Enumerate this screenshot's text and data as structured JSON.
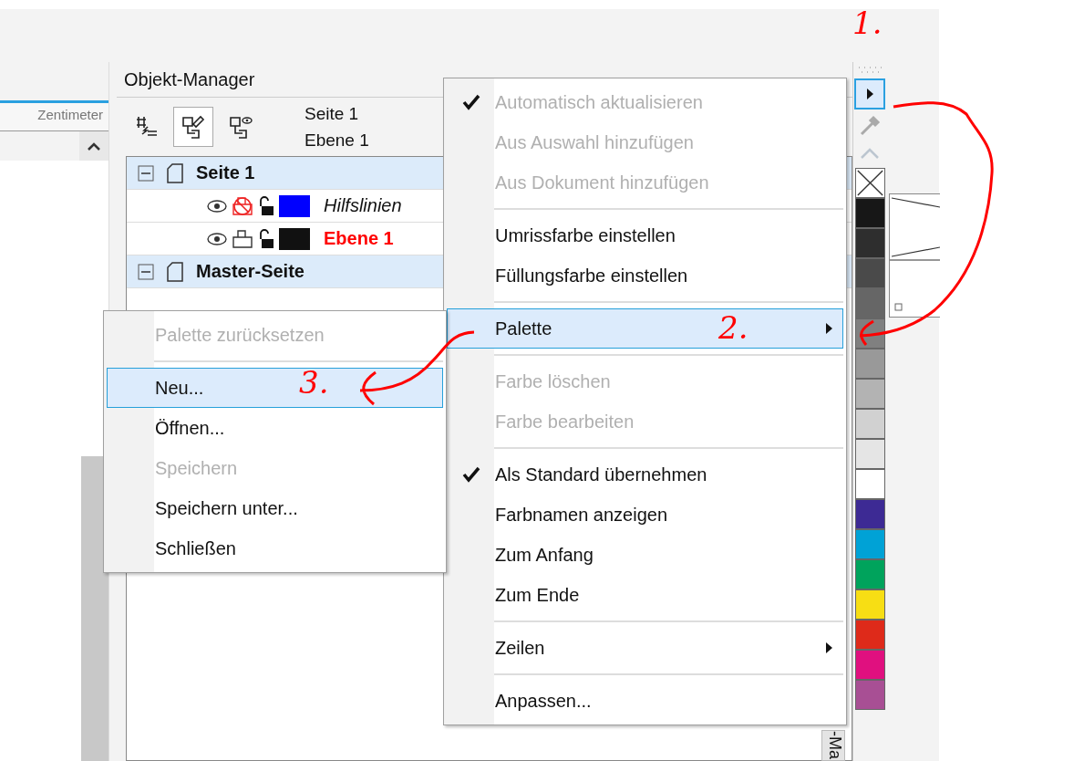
{
  "ruler": {
    "unit": "Zentimeter"
  },
  "object_manager": {
    "title": "Objekt-Manager",
    "toolbar": [
      {
        "selected": false
      },
      {
        "selected": true
      },
      {
        "selected": false
      }
    ],
    "current": {
      "page": "Seite 1",
      "layer": "Ebene 1"
    },
    "tree": [
      {
        "kind": "page",
        "name": "Seite 1",
        "expanded": true,
        "children": [
          {
            "kind": "layer",
            "name": "Hilfslinien",
            "visible": true,
            "printable": false,
            "locked": false,
            "color": "#0000ff",
            "active": false,
            "guides": true
          },
          {
            "kind": "layer",
            "name": "Ebene 1",
            "visible": true,
            "printable": true,
            "locked": false,
            "color": "#111111",
            "active": true,
            "guides": false
          }
        ]
      },
      {
        "kind": "page",
        "name": "Master-Seite",
        "expanded": true
      }
    ],
    "side_tab": "-Ma"
  },
  "context_menu": {
    "items": [
      {
        "kind": "item",
        "label": "Automatisch aktualisieren",
        "disabled": true,
        "checked": true,
        "submenu": false,
        "selected": false
      },
      {
        "kind": "item",
        "label": "Aus Auswahl hinzufügen",
        "disabled": true,
        "checked": false,
        "submenu": false,
        "selected": false
      },
      {
        "kind": "item",
        "label": "Aus Dokument hinzufügen",
        "disabled": true,
        "checked": false,
        "submenu": false,
        "selected": false
      },
      {
        "kind": "separator"
      },
      {
        "kind": "item",
        "label": "Umrissfarbe einstellen",
        "disabled": false,
        "checked": false,
        "submenu": false,
        "selected": false
      },
      {
        "kind": "item",
        "label": "Füllungsfarbe einstellen",
        "disabled": false,
        "checked": false,
        "submenu": false,
        "selected": false
      },
      {
        "kind": "separator"
      },
      {
        "kind": "item",
        "label": "Palette",
        "disabled": false,
        "checked": false,
        "submenu": true,
        "selected": true
      },
      {
        "kind": "separator"
      },
      {
        "kind": "item",
        "label": "Farbe löschen",
        "disabled": true,
        "checked": false,
        "submenu": false,
        "selected": false
      },
      {
        "kind": "item",
        "label": "Farbe bearbeiten",
        "disabled": true,
        "checked": false,
        "submenu": false,
        "selected": false
      },
      {
        "kind": "separator"
      },
      {
        "kind": "item",
        "label": "Als Standard übernehmen",
        "disabled": false,
        "checked": true,
        "submenu": false,
        "selected": false
      },
      {
        "kind": "item",
        "label": "Farbnamen anzeigen",
        "disabled": false,
        "checked": false,
        "submenu": false,
        "selected": false
      },
      {
        "kind": "item",
        "label": "Zum Anfang",
        "disabled": false,
        "checked": false,
        "submenu": false,
        "selected": false
      },
      {
        "kind": "item",
        "label": "Zum Ende",
        "disabled": false,
        "checked": false,
        "submenu": false,
        "selected": false
      },
      {
        "kind": "separator"
      },
      {
        "kind": "item",
        "label": "Zeilen",
        "disabled": false,
        "checked": false,
        "submenu": true,
        "selected": false
      },
      {
        "kind": "separator"
      },
      {
        "kind": "item",
        "label": "Anpassen...",
        "disabled": false,
        "checked": false,
        "submenu": false,
        "selected": false
      }
    ]
  },
  "palette_submenu": {
    "items": [
      {
        "kind": "item",
        "label": "Palette zurücksetzen",
        "disabled": true,
        "checked": false,
        "submenu": false,
        "selected": false
      },
      {
        "kind": "separator"
      },
      {
        "kind": "item",
        "label": "Neu...",
        "disabled": false,
        "checked": false,
        "submenu": false,
        "selected": true
      },
      {
        "kind": "item",
        "label": "Öffnen...",
        "disabled": false,
        "checked": false,
        "submenu": false,
        "selected": false
      },
      {
        "kind": "item",
        "label": "Speichern",
        "disabled": true,
        "checked": false,
        "submenu": false,
        "selected": false
      },
      {
        "kind": "item",
        "label": "Speichern unter...",
        "disabled": false,
        "checked": false,
        "submenu": false,
        "selected": false
      },
      {
        "kind": "item",
        "label": "Schließen",
        "disabled": false,
        "checked": false,
        "submenu": false,
        "selected": false
      }
    ]
  },
  "palette": {
    "menu_button_selected": true,
    "swatches": [
      {
        "kind": "none"
      },
      {
        "kind": "color",
        "color": "#171717"
      },
      {
        "kind": "color",
        "color": "#2e2e2e"
      },
      {
        "kind": "color",
        "color": "#4a4a4a"
      },
      {
        "kind": "color",
        "color": "#666666"
      },
      {
        "kind": "color",
        "color": "#808080"
      },
      {
        "kind": "color",
        "color": "#999999"
      },
      {
        "kind": "color",
        "color": "#b3b3b3"
      },
      {
        "kind": "color",
        "color": "#d1d1d1"
      },
      {
        "kind": "color",
        "color": "#e5e5e5"
      },
      {
        "kind": "color",
        "color": "#ffffff"
      },
      {
        "kind": "color",
        "color": "#3d2a94"
      },
      {
        "kind": "color",
        "color": "#00a2d6"
      },
      {
        "kind": "color",
        "color": "#00a35c"
      },
      {
        "kind": "color",
        "color": "#f7de14"
      },
      {
        "kind": "color",
        "color": "#de2a1a"
      },
      {
        "kind": "color",
        "color": "#e0107f"
      },
      {
        "kind": "color",
        "color": "#a84f94"
      }
    ]
  },
  "annotations": [
    {
      "text": "1."
    },
    {
      "text": "2."
    },
    {
      "text": "3."
    }
  ]
}
